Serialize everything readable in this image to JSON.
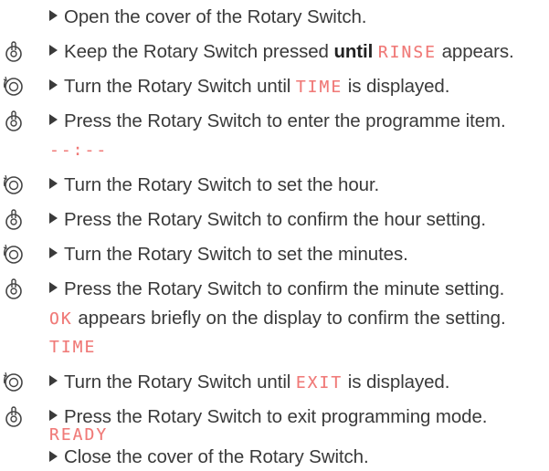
{
  "steps": {
    "s1": "Open the cover of the Rotary Switch.",
    "s2_a": "Keep the Rotary Switch pressed ",
    "s2_bold": "until",
    "s2_lcd": "RINSE",
    "s2_b": " appears.",
    "s3_a": "Turn the Rotary Switch until ",
    "s3_lcd": "TIME",
    "s3_b": " is displayed.",
    "s4": "Press the Rotary Switch to enter the programme item.",
    "s4_lcd": "--:--",
    "s5": "Turn the Rotary Switch to set the hour.",
    "s6": "Press the Rotary Switch to confirm the hour setting.",
    "s7": "Turn the Rotary Switch to set the minutes.",
    "s8": "Press the Rotary Switch to confirm the minute setting.",
    "s8_lcd": "OK",
    "s8_note": " appears briefly on the display to confirm the setting.",
    "s8_lcd2": "TIME",
    "s9_a": "Turn the Rotary Switch until ",
    "s9_lcd": "EXIT",
    "s9_b": " is displayed.",
    "s10": "Press the Rotary Switch to exit programming mode.",
    "s10_lcd": "READY",
    "s11": "Close the cover of the Rotary Switch."
  },
  "colors": {
    "lcd": "#f07a78",
    "text": "#3a3a3a"
  },
  "icons": {
    "press": "press-hand-icon",
    "turn": "rotate-icon"
  }
}
